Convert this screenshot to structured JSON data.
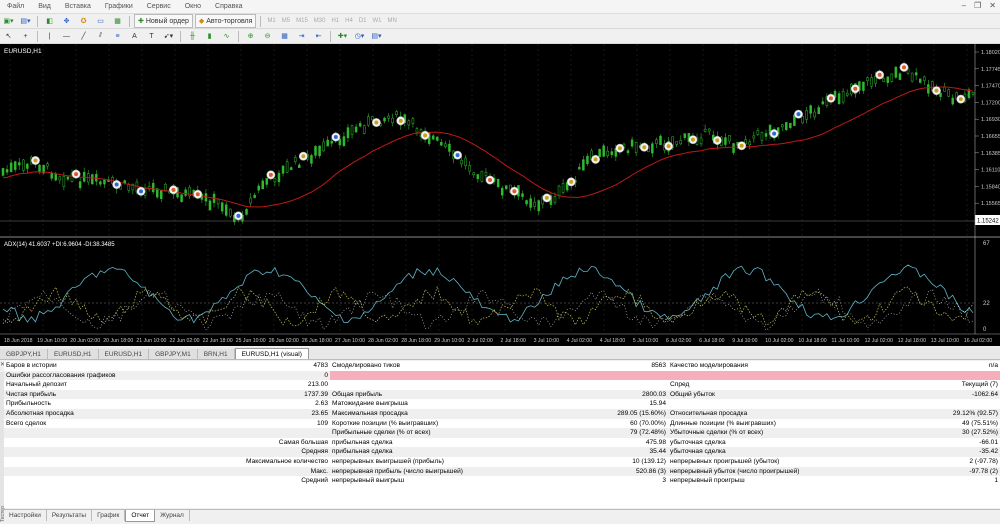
{
  "menu": [
    "Файл",
    "Вид",
    "Вставка",
    "Графики",
    "Сервис",
    "Окно",
    "Справка"
  ],
  "toolbar": {
    "new_order_label": "Новый ордер",
    "autotrade_label": "Авто-торговля",
    "timeframes": [
      "M1",
      "M5",
      "M15",
      "M30",
      "H1",
      "H4",
      "D1",
      "W1",
      "MN"
    ]
  },
  "chart": {
    "symbol_label": "EURUSD,H1",
    "price_scale": [
      "1.18020",
      "1.17745",
      "1.17470",
      "1.17200",
      "1.16930",
      "1.16655",
      "1.16385",
      "1.16110",
      "1.15840",
      "1.15565",
      "1.15295"
    ],
    "current_price": "1.15242",
    "adx_label": "ADX(14) 41.6037 +DI:6.9604 -DI:38.3485",
    "adx_scale_top": "67",
    "adx_level": "22",
    "adx_scale_bottom": "0",
    "time_axis": [
      "18 Jun 2018",
      "19 Jun 10:00",
      "20 Jun 02:00",
      "20 Jun 18:00",
      "21 Jun 10:00",
      "22 Jun 02:00",
      "22 Jun 18:00",
      "25 Jun 10:00",
      "26 Jun 02:00",
      "26 Jun 18:00",
      "27 Jun 10:00",
      "28 Jun 02:00",
      "28 Jun 18:00",
      "29 Jun 10:00",
      "2 Jul 02:00",
      "2 Jul 18:00",
      "3 Jul 10:00",
      "4 Jul 02:00",
      "4 Jul 18:00",
      "5 Jul 10:00",
      "6 Jul 02:00",
      "6 Jul 18:00",
      "9 Jul 10:00",
      "10 Jul 02:00",
      "10 Jul 18:00",
      "11 Jul 10:00",
      "12 Jul 02:00",
      "12 Jul 18:00",
      "13 Jul 10:00",
      "16 Jul 02:00"
    ]
  },
  "symbol_tabs": [
    "GBPJPY,H1",
    "EURUSD,H1",
    "EURUSD,H1",
    "GBPJPY,M1",
    "BRN,H1",
    "EURUSD,H1 (visual)"
  ],
  "report": {
    "rows": [
      [
        "Баров в истории",
        "4783",
        "Смоделировано тиков",
        "8563",
        "Качество моделирования",
        "n/a"
      ],
      [
        "Ошибки рассогласования графиков",
        "0",
        "",
        "",
        "",
        ""
      ],
      [
        "Начальный депозит",
        "213.00",
        "",
        "",
        "Спред",
        "Текущий (7)"
      ],
      [
        "Чистая прибыль",
        "1737.39",
        "Общая прибыль",
        "2800.03",
        "Общий убыток",
        "-1062.64"
      ],
      [
        "Прибыльность",
        "2.63",
        "Матожидание выигрыша",
        "15.94",
        "",
        ""
      ],
      [
        "Абсолютная просадка",
        "23.65",
        "Максимальная просадка",
        "289.05 (15.60%)",
        "Относительная просадка",
        "29.12% (92.57)"
      ],
      [
        "Всего сделок",
        "109",
        "Короткие позиции (% выигравших)",
        "60 (70.00%)",
        "Длинные позиции (% выигравших)",
        "49 (75.51%)"
      ],
      [
        "",
        "",
        "Прибыльные сделки (% от всех)",
        "79 (72.48%)",
        "Убыточные сделки (% от всех)",
        "30 (27.52%)"
      ],
      [
        "",
        "Самая большая",
        "прибыльная сделка",
        "475.98",
        "убыточная сделка",
        "-66.01"
      ],
      [
        "",
        "Средняя",
        "прибыльная сделка",
        "35.44",
        "убыточная сделка",
        "-35.42"
      ],
      [
        "",
        "Максимальное количество",
        "непрерывных выигрышей (прибыль)",
        "10 (139.12)",
        "непрерывных проигрышей (убыток)",
        "2 (-97.78)"
      ],
      [
        "",
        "Макс.",
        "непрерывная прибыль (число выигрышей)",
        "520.86 (3)",
        "непрерывный убыток (число проигрышей)",
        "-97.78 (2)"
      ],
      [
        "",
        "Средний",
        "непрерывный выигрыш",
        "3",
        "непрерывный проигрыш",
        "1"
      ]
    ]
  },
  "side_label": "Тестер",
  "bottom_tabs": [
    "Настройки",
    "Результаты",
    "График",
    "Отчет",
    "Журнал"
  ]
}
